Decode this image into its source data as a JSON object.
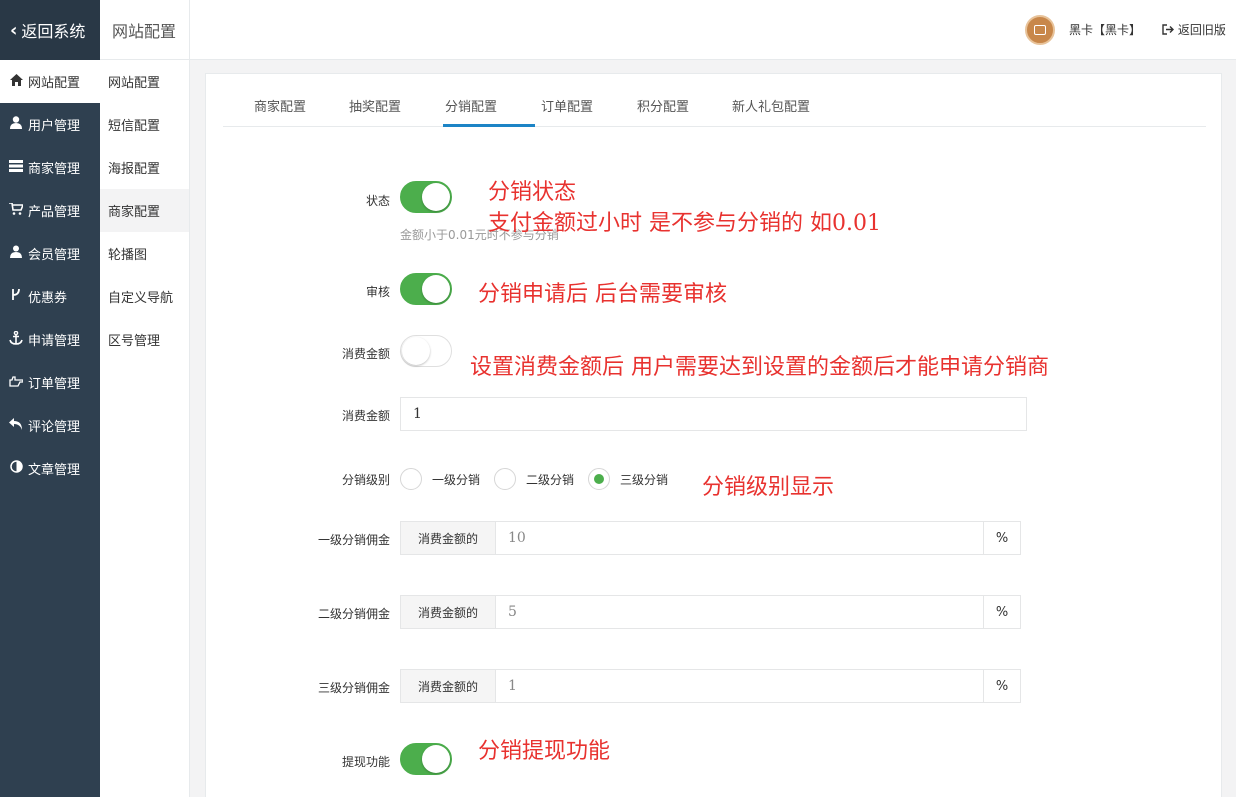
{
  "sidebar": {
    "back_label": "返回系统",
    "items": [
      {
        "label": "网站配置",
        "icon": "home-icon"
      },
      {
        "label": "用户管理",
        "icon": "user-icon"
      },
      {
        "label": "商家管理",
        "icon": "server-icon"
      },
      {
        "label": "产品管理",
        "icon": "cart-icon"
      },
      {
        "label": "会员管理",
        "icon": "users-icon"
      },
      {
        "label": "优惠券",
        "icon": "branch-icon"
      },
      {
        "label": "申请管理",
        "icon": "anchor-icon"
      },
      {
        "label": "订单管理",
        "icon": "hand-icon"
      },
      {
        "label": "评论管理",
        "icon": "reply-icon"
      },
      {
        "label": "文章管理",
        "icon": "contrast-icon"
      }
    ]
  },
  "subnav": {
    "title": "网站配置",
    "items": [
      {
        "label": "网站配置"
      },
      {
        "label": "短信配置"
      },
      {
        "label": "海报配置"
      },
      {
        "label": "商家配置"
      },
      {
        "label": "轮播图"
      },
      {
        "label": "自定义导航"
      },
      {
        "label": "区号管理"
      }
    ]
  },
  "topbar": {
    "user_name": "黑卡【黑卡】",
    "old_version": "返回旧版"
  },
  "tabs": [
    {
      "label": "商家配置"
    },
    {
      "label": "抽奖配置"
    },
    {
      "label": "分销配置"
    },
    {
      "label": "订单配置"
    },
    {
      "label": "积分配置"
    },
    {
      "label": "新人礼包配置"
    }
  ],
  "form": {
    "status": {
      "label": "状态",
      "on": true,
      "hint": "金额小于0.01元时不参与分销"
    },
    "review": {
      "label": "审核",
      "on": true
    },
    "spend_toggle": {
      "label": "消费金额",
      "on": false
    },
    "spend_amount": {
      "label": "消费金额",
      "value": "1"
    },
    "level": {
      "label": "分销级别",
      "options": [
        {
          "label": "一级分销",
          "checked": false
        },
        {
          "label": "二级分销",
          "checked": false
        },
        {
          "label": "三级分销",
          "checked": true
        }
      ]
    },
    "commission": [
      {
        "label": "一级分销佣金",
        "prefix": "消费金额的",
        "value": "10",
        "suffix": "%"
      },
      {
        "label": "二级分销佣金",
        "prefix": "消费金额的",
        "value": "5",
        "suffix": "%"
      },
      {
        "label": "三级分销佣金",
        "prefix": "消费金额的",
        "value": "1",
        "suffix": "%"
      }
    ],
    "withdraw": {
      "label": "提现功能",
      "on": true
    }
  },
  "annotations": {
    "a1": "分销状态",
    "a2": "支付金额过小时 是不参与分销的 如0.01",
    "a3": "分销申请后 后台需要审核",
    "a4": "设置消费金额后 用户需要达到设置的金额后才能申请分销商",
    "a5": "分销级别显示",
    "a6": "分销提现功能"
  },
  "colors": {
    "sidebar_bg": "#2f4050",
    "toggle_on": "#4cae4c",
    "tab_active": "#1c84c6",
    "annotation": "#e8322f"
  }
}
